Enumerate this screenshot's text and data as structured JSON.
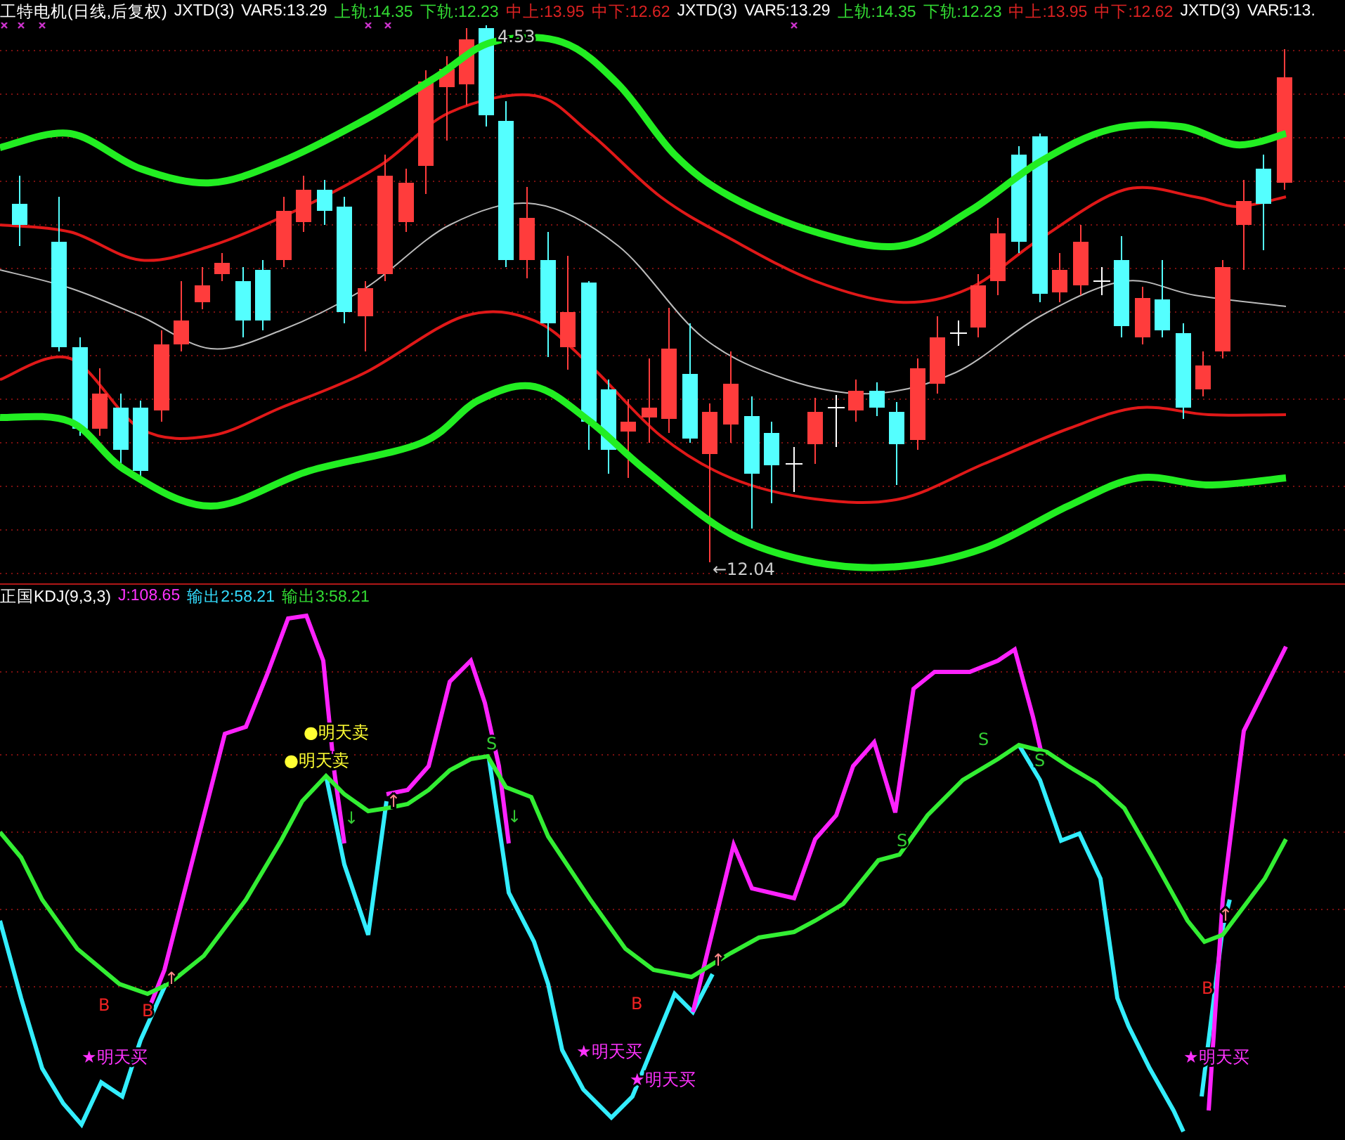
{
  "price_panel": {
    "legend": [
      {
        "text": "工特电机(日线,后复权)",
        "color": "#ffffff"
      },
      {
        "text": "JXTD(3)",
        "color": "#ffffff"
      },
      {
        "text": "VAR5:13.29",
        "color": "#ffffff"
      },
      {
        "text": "上轨:14.35",
        "color": "#33dd33"
      },
      {
        "text": "下轨:12.23",
        "color": "#33dd33"
      },
      {
        "text": "中上:13.95",
        "color": "#dd2222"
      },
      {
        "text": "中下:12.62",
        "color": "#dd2222"
      },
      {
        "text": "JXTD(3)",
        "color": "#ffffff"
      },
      {
        "text": "VAR5:13.29",
        "color": "#ffffff"
      },
      {
        "text": "上轨:14.35",
        "color": "#33dd33"
      },
      {
        "text": "下轨:12.23",
        "color": "#33dd33"
      },
      {
        "text": "中上:13.95",
        "color": "#dd2222"
      },
      {
        "text": "中下:12.62",
        "color": "#dd2222"
      },
      {
        "text": "JXTD(3)",
        "color": "#ffffff"
      },
      {
        "text": "VAR5:13.",
        "color": "#ffffff"
      }
    ],
    "price_labels": [
      {
        "text": "4.53",
        "kind": "high"
      },
      {
        "text": "←12.04",
        "kind": "low"
      }
    ]
  },
  "indicator_panel": {
    "legend": [
      {
        "text": "正国KDJ(9,3,3)",
        "color": "#ffffff"
      },
      {
        "text": "J:108.65",
        "color": "#ff33ff"
      },
      {
        "text": "输出2:58.21",
        "color": "#33ddff"
      },
      {
        "text": "输出3:58.21",
        "color": "#33dd33"
      }
    ],
    "signals": [
      {
        "text": "●明天卖",
        "kind": "sell"
      },
      {
        "text": "●明天卖",
        "kind": "sell"
      },
      {
        "text": "★明天买",
        "kind": "buy"
      },
      {
        "text": "★明天买",
        "kind": "buy"
      },
      {
        "text": "★明天买",
        "kind": "buy"
      },
      {
        "text": "★明天买",
        "kind": "buy"
      },
      {
        "text": "B",
        "kind": "b"
      },
      {
        "text": "B",
        "kind": "b"
      },
      {
        "text": "B",
        "kind": "b"
      },
      {
        "text": "B",
        "kind": "b"
      },
      {
        "text": "S",
        "kind": "s"
      },
      {
        "text": "S",
        "kind": "s"
      },
      {
        "text": "S",
        "kind": "s"
      },
      {
        "text": "S",
        "kind": "s"
      },
      {
        "text": "↑",
        "kind": "up"
      },
      {
        "text": "↑",
        "kind": "up"
      },
      {
        "text": "↑",
        "kind": "up"
      },
      {
        "text": "↑",
        "kind": "up"
      },
      {
        "text": "↓",
        "kind": "down"
      },
      {
        "text": "↓",
        "kind": "down"
      }
    ]
  }
}
